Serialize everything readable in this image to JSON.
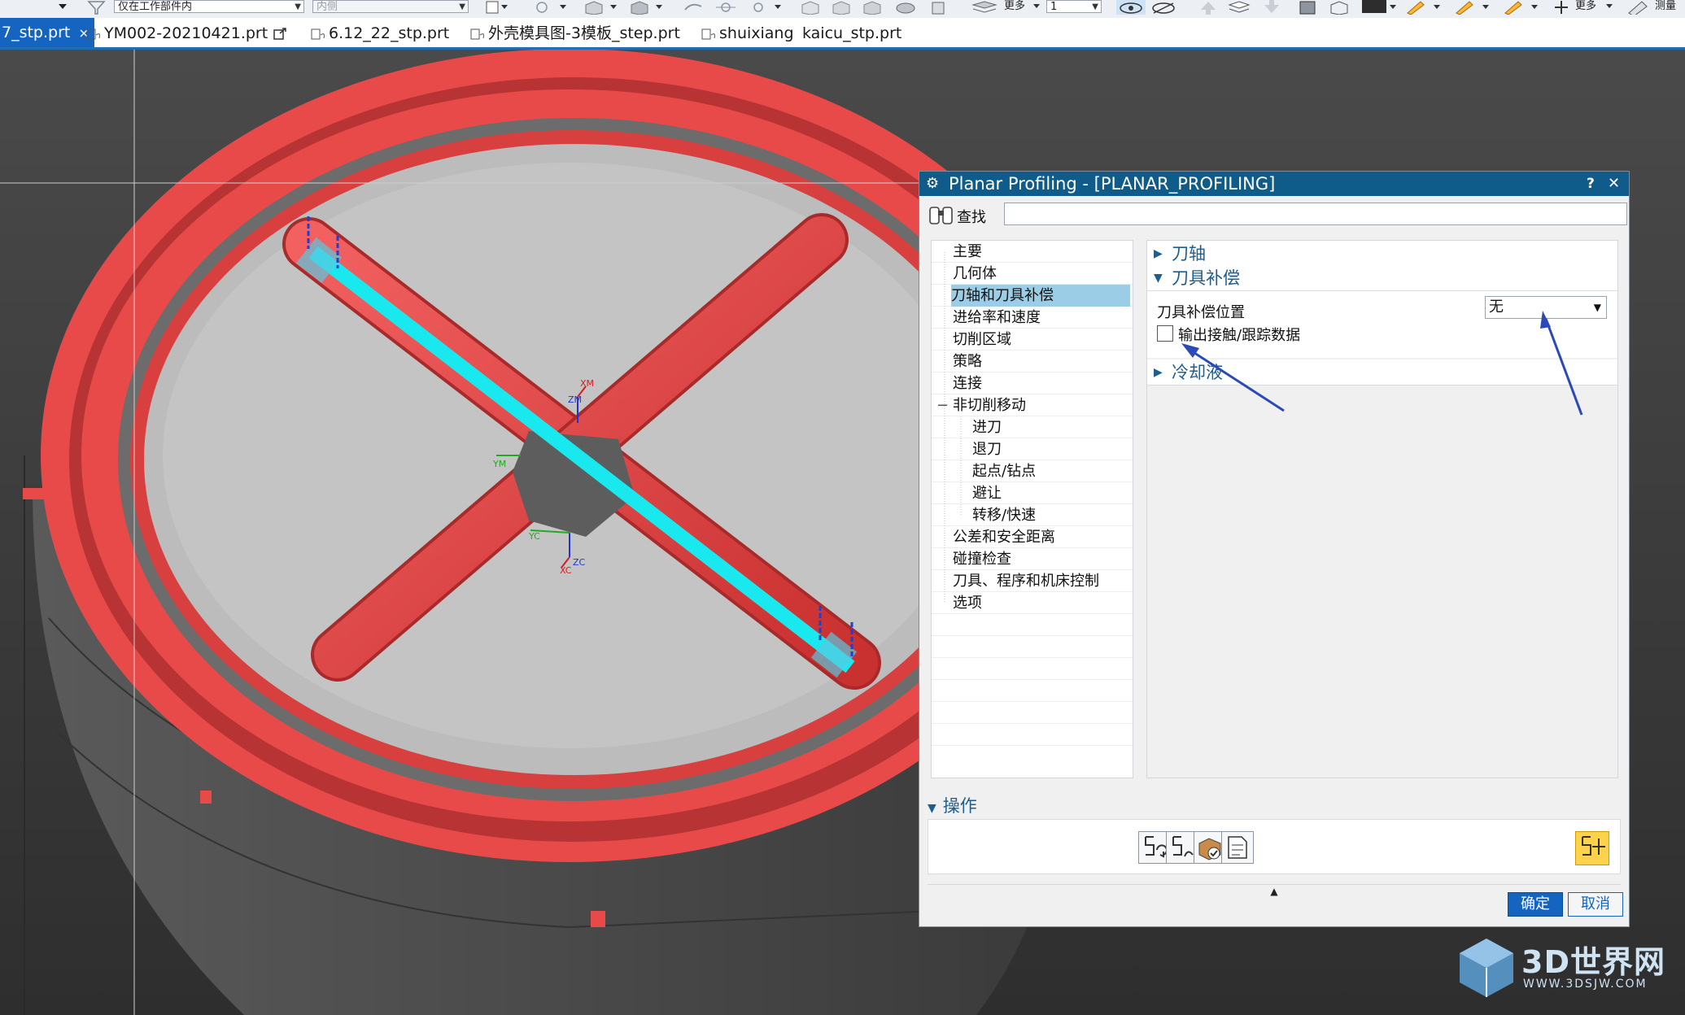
{
  "toolbar": {
    "filter_combo": "仅在工作部件内",
    "inner_combo": "内侧",
    "more_label_1": "更多",
    "more_label_2": "更多",
    "measure_label": "测量"
  },
  "tabs": [
    {
      "label": "7_stp.prt",
      "close": "×"
    },
    {
      "label": "YM002-20210421.prt"
    },
    {
      "label": "6.12_22_stp.prt"
    },
    {
      "label": "外壳模具图-3模板_step.prt"
    },
    {
      "label": "shuixiang"
    },
    {
      "label": "kaicu_stp.prt"
    }
  ],
  "viewport": {
    "axis_labels": {
      "xm": "XM",
      "zm": "ZM",
      "ym": "YM",
      "yc": "YC",
      "zc": "ZC",
      "xc": "XC"
    },
    "colors": {
      "background": "#3a3a3a",
      "part_red": "#e84a4a",
      "toolpath": "#19e9ee",
      "floor": "#bcbcbc"
    }
  },
  "dialog": {
    "title": "Planar Profiling - [PLANAR_PROFILING]",
    "help": "?",
    "close": "✕",
    "find_label": "查找",
    "find_value": "",
    "nav": [
      {
        "label": "主要"
      },
      {
        "label": "几何体"
      },
      {
        "label": "刀轴和刀具补偿",
        "selected": true
      },
      {
        "label": "进给率和速度"
      },
      {
        "label": "切削区域"
      },
      {
        "label": "策略"
      },
      {
        "label": "连接"
      },
      {
        "label": "非切削移动",
        "collapse": "−"
      },
      {
        "label": "进刀"
      },
      {
        "label": "退刀"
      },
      {
        "label": "起点/钻点"
      },
      {
        "label": "避让"
      },
      {
        "label": "转移/快速"
      },
      {
        "label": "公差和安全距离"
      },
      {
        "label": "碰撞检查"
      },
      {
        "label": "刀具、程序和机床控制"
      },
      {
        "label": "选项"
      }
    ],
    "groups": {
      "tool_axis": {
        "label": "刀轴",
        "expanded": false
      },
      "tool_comp": {
        "label": "刀具补偿",
        "expanded": true,
        "position_label": "刀具补偿位置",
        "position_value": "无",
        "checkbox_label": "输出接触/跟踪数据",
        "checkbox_checked": false
      },
      "coolant": {
        "label": "冷却液",
        "expanded": false
      }
    },
    "operations": {
      "label": "操作"
    },
    "expander": "▲",
    "ok": "确定",
    "cancel": "取消"
  },
  "watermark": {
    "main": "3D世界网",
    "sub": "WWW.3DSJW.COM"
  }
}
